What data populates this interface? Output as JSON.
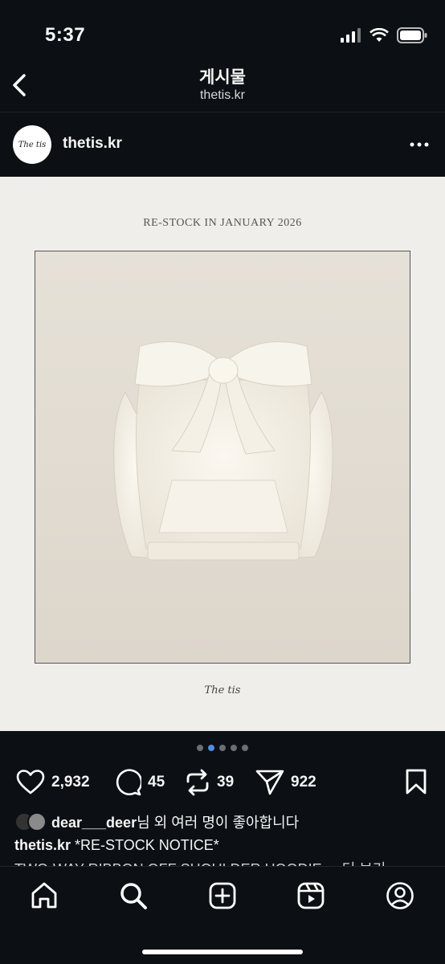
{
  "status": {
    "time": "5:37"
  },
  "nav": {
    "title": "게시물",
    "subtitle": "thetis.kr"
  },
  "post": {
    "username": "thetis.kr",
    "avatar_text": "The tis",
    "image_caption": "RE-STOCK IN JANUARY 2026",
    "brand_mark": "The tis",
    "carousel": {
      "count": 5,
      "active_index": 1
    }
  },
  "actions": {
    "likes": "2,932",
    "comments": "45",
    "reposts": "39",
    "shares": "922"
  },
  "liked_by": {
    "user": "dear___deer",
    "suffix": "님 외 여러 명이 좋아합니다"
  },
  "caption": {
    "user": "thetis.kr",
    "text": "*RE-STOCK NOTICE*",
    "second_line": "TWO-WAY RIBBON OFF SHOULDER HOODIE ... 더 보기"
  },
  "colors": {
    "background": "#0c1014",
    "accent_dot": "#4a90e2"
  },
  "icons": [
    "back-chevron-icon",
    "more-icon",
    "heart-icon",
    "comment-icon",
    "repost-icon",
    "share-icon",
    "bookmark-icon",
    "home-icon",
    "search-icon",
    "create-icon",
    "reels-icon",
    "profile-icon"
  ]
}
